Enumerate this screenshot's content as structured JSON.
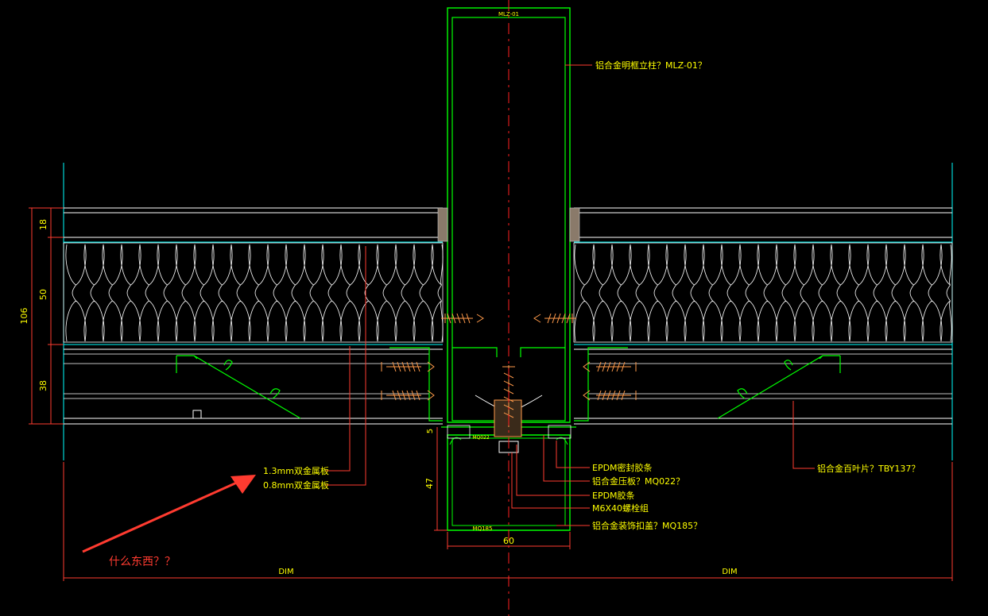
{
  "drawing": {
    "tag_top": "MLZ-01",
    "tag_bottom": "MQ185",
    "tag_clip": "MQ022"
  },
  "callouts": {
    "mullion": "铝合金明框立柱？MLZ-01？",
    "panel_1_3": "1.3mm双金属板",
    "panel_0_8": "0.8mm双金属板",
    "epdm_seal": "EPDM密封胶条",
    "pressure_plate": "铝合金压板？MQ022？",
    "epdm_strip": "EPDM胶条",
    "bolt": "M6X40螺栓组",
    "cover_cap": "铝合金装饰扣盖？MQ185？",
    "louver": "铝合金百叶片？TBY137？"
  },
  "dimensions": {
    "d18": "18",
    "d50": "50",
    "d106": "106",
    "d38": "38",
    "d5": "5",
    "d47": "47",
    "d60": "60",
    "dim_left": "DIM",
    "dim_right": "DIM"
  },
  "annotation": {
    "question": "什么东西？？"
  },
  "colors": {
    "background": "#000000",
    "profile": "#00ff00",
    "annotation": "#ff3b30",
    "text": "#ffff00",
    "thin_line": "#ffffff",
    "cyan": "#00ffff",
    "bolt": "#ff9a4a",
    "center_line": "#ff2020"
  }
}
